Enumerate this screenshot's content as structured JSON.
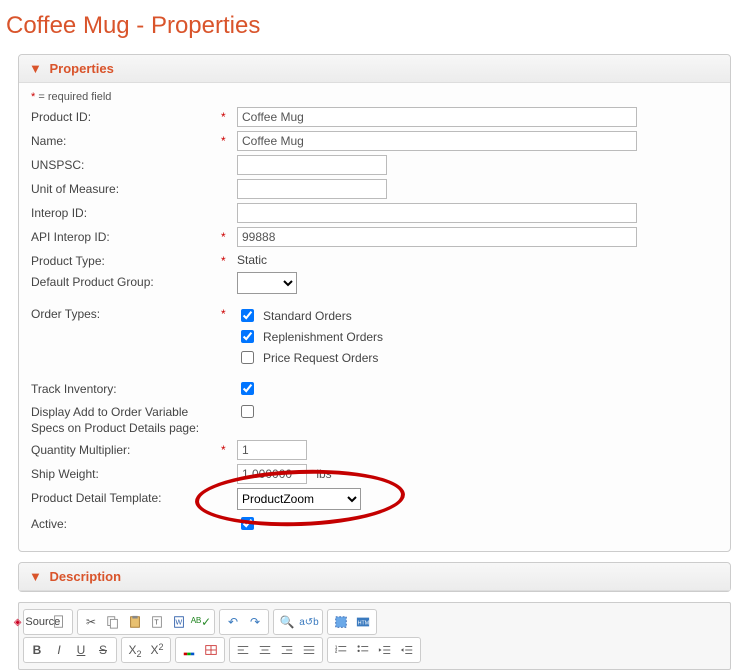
{
  "page_title": "Coffee Mug - Properties",
  "panels": {
    "properties": {
      "title": "Properties"
    },
    "description": {
      "title": "Description"
    }
  },
  "required_note": "= required field",
  "labels": {
    "product_id": "Product ID:",
    "name": "Name:",
    "unspsc": "UNSPSC:",
    "uom": "Unit of Measure:",
    "interop_id": "Interop ID:",
    "api_interop_id": "API Interop ID:",
    "product_type": "Product Type:",
    "default_group": "Default Product Group:",
    "order_types": "Order Types:",
    "track_inventory": "Track Inventory:",
    "display_variable": "Display Add to Order Variable Specs on Product Details page:",
    "qty_multiplier": "Quantity Multiplier:",
    "ship_weight": "Ship Weight:",
    "product_detail_template": "Product Detail Template:",
    "active": "Active:"
  },
  "values": {
    "product_id": "Coffee Mug",
    "name": "Coffee Mug",
    "unspsc": "",
    "uom": "",
    "interop_id": "",
    "api_interop_id": "99888",
    "product_type": "Static",
    "default_group": "",
    "order_types": {
      "standard": {
        "label": "Standard Orders",
        "checked": true
      },
      "replenishment": {
        "label": "Replenishment Orders",
        "checked": true
      },
      "price_request": {
        "label": "Price Request Orders",
        "checked": false
      }
    },
    "track_inventory": true,
    "display_variable": false,
    "qty_multiplier": "1",
    "ship_weight": "1.000000",
    "ship_weight_unit": "lbs",
    "product_detail_template": "ProductZoom",
    "active": true
  },
  "editor": {
    "source_label": "Source"
  }
}
